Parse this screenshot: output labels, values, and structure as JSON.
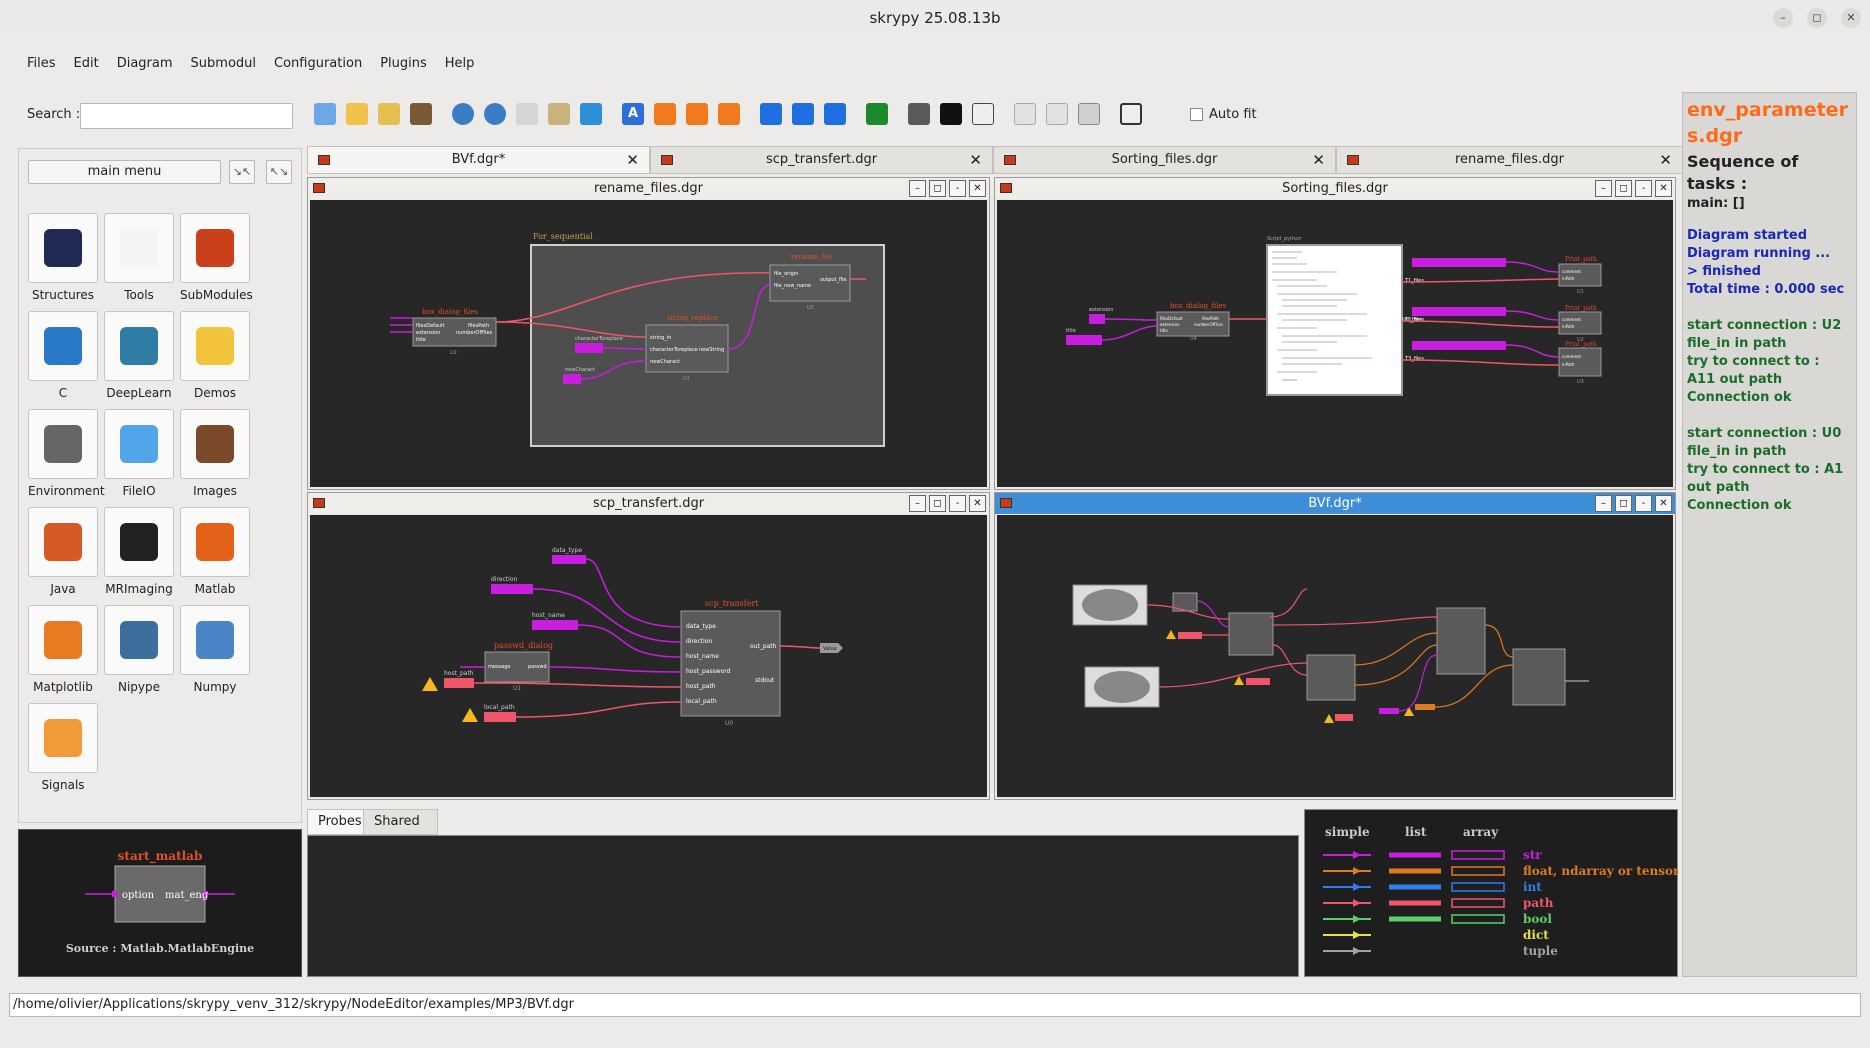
{
  "window": {
    "title": "skrypy 25.08.13b"
  },
  "menu": [
    "Files",
    "Edit",
    "Diagram",
    "Submodul",
    "Configuration",
    "Plugins",
    "Help"
  ],
  "search": {
    "label": "Search :",
    "value": ""
  },
  "toolbar": {
    "icons": [
      "new-file-icon",
      "open-folder-icon",
      "open-recent-icon",
      "edit-icon",
      "undo-icon",
      "redo-icon",
      "copy-icon",
      "paste-icon",
      "refresh-icon",
      "text-icon",
      "run-icon",
      "run-step-icon",
      "run-all-icon",
      "play-icon",
      "play-step-icon",
      "play-all-icon",
      "run-thread-icon",
      "tools-icon",
      "terminal-icon",
      "document-icon",
      "window-cascade-icon",
      "window-tile-icon",
      "window-grid-icon",
      "fit-screen-icon"
    ],
    "autofit_label": "Auto fit",
    "autofit_checked": false
  },
  "left_panel": {
    "main_menu_label": "main menu",
    "libraries": [
      {
        "label": "Structures",
        "icon": "structures-icon"
      },
      {
        "label": "Tools",
        "icon": "tools-icon"
      },
      {
        "label": "SubModules",
        "icon": "submodules-icon"
      },
      {
        "label": "C",
        "icon": "c-icon"
      },
      {
        "label": "DeepLearn",
        "icon": "deeplearn-icon"
      },
      {
        "label": "Demos",
        "icon": "python-icon"
      },
      {
        "label": "Environment",
        "icon": "gear-icon"
      },
      {
        "label": "FileIO",
        "icon": "file-icon"
      },
      {
        "label": "Images",
        "icon": "image-icon"
      },
      {
        "label": "Java",
        "icon": "java-icon"
      },
      {
        "label": "MRImaging",
        "icon": "mri-icon"
      },
      {
        "label": "Matlab",
        "icon": "matlab-icon"
      },
      {
        "label": "Matplotlib",
        "icon": "matplotlib-icon"
      },
      {
        "label": "Nipype",
        "icon": "brain-icon"
      },
      {
        "label": "Numpy",
        "icon": "numpy-icon"
      },
      {
        "label": "Signals",
        "icon": "signal-icon"
      }
    ],
    "preview": {
      "node": "start_matlab",
      "in_port": "option",
      "out_port": "mat_eng",
      "source": "Source : Matlab.MatlabEngine"
    }
  },
  "tabs": [
    {
      "label": "BVf.dgr*",
      "active": true
    },
    {
      "label": "scp_transfert.dgr",
      "active": false
    },
    {
      "label": "Sorting_files.dgr",
      "active": false
    },
    {
      "label": "rename_files.dgr",
      "active": false
    }
  ],
  "subwindows": [
    {
      "title": "rename_files.dgr",
      "active": false
    },
    {
      "title": "Sorting_files.dgr",
      "active": false
    },
    {
      "title": "scp_transfert.dgr",
      "active": false
    },
    {
      "title": "BVf.dgr*",
      "active": true
    }
  ],
  "diagram_text": {
    "rename": {
      "group": "For_sequential",
      "n1": "box_dialog_files",
      "n1_in": [
        "filesDefault",
        "extension",
        "title"
      ],
      "n1_out": [
        "filesPath",
        "numberOfFiles"
      ],
      "n1_id": "U2",
      "n2": "rename_file",
      "n2_in": [
        "file_origin",
        "file_new_name"
      ],
      "n2_out": "output_file",
      "n2_id": "U3",
      "n3": "string_replace",
      "n3_in": [
        "string_in",
        "characterToreplace",
        "newCharact"
      ],
      "n3_out": "newString",
      "n3_id": "U1",
      "c1": "characterToreplace",
      "c2": "newCharact"
    },
    "sorting": {
      "n1": "box_dialog_files",
      "n1_in": [
        "filesDefault",
        "extension",
        "title"
      ],
      "n1_out": [
        "filesPath",
        "numberOfFiles"
      ],
      "n1_id": "U4",
      "script_title": "Script_python",
      "script_out": "list_files",
      "labels": [
        "extension",
        "title"
      ],
      "outs": [
        "T1_files",
        "T2_files",
        "T3_files"
      ],
      "print": "Print_path",
      "print_in": [
        "comment",
        "inPath"
      ],
      "print_ids": [
        "U1",
        "U2",
        "U3"
      ]
    },
    "scp": {
      "n1": "passwd_dialog",
      "n1_in": "message",
      "n1_out": "passwd",
      "n1_id": "U1",
      "n2": "scp_transfert",
      "n2_in": [
        "data_type",
        "direction",
        "host_name",
        "host_password",
        "host_path",
        "local_path"
      ],
      "n2_out": [
        "out_path",
        "stdout"
      ],
      "n2_id": "U0",
      "c": [
        "data_type",
        "direction",
        "host_name",
        "host_path",
        "local_path"
      ],
      "val": "Value"
    }
  },
  "bottom_tabs": [
    {
      "label": "Probes",
      "active": true
    },
    {
      "label": "Shared Memory",
      "active": false
    }
  ],
  "legend": {
    "headers": [
      "simple",
      "list",
      "array"
    ],
    "types": [
      {
        "name": "str",
        "color": "#c81ee0"
      },
      {
        "name": "float, ndarray or tensor",
        "color": "#e07a1e"
      },
      {
        "name": "int",
        "color": "#2f7df0"
      },
      {
        "name": "path",
        "color": "#f0566a"
      },
      {
        "name": "bool",
        "color": "#5ad06a"
      },
      {
        "name": "dict",
        "color": "#e8e24a"
      },
      {
        "name": "tuple",
        "color": "#a3a3a3"
      }
    ]
  },
  "right_panel": {
    "title": "env_parameters.dgr",
    "seq": "Sequence of tasks :",
    "main": "main: []",
    "status": [
      "Diagram started",
      "Diagram running ...",
      "> finished",
      "Total time : 0.000 sec"
    ],
    "log": [
      {
        "text": "start connection : U2",
        "color": "dark"
      },
      {
        "text": "file_in in path",
        "color": "dark"
      },
      {
        "text": "try to connect to : A11 out path",
        "color": "dark"
      },
      {
        "text": "Connection ok",
        "color": "dark"
      },
      {
        "text": "",
        "color": "dark"
      },
      {
        "text": "start connection : U0",
        "color": "dark"
      },
      {
        "text": "file_in in path",
        "color": "dark"
      },
      {
        "text": "try to connect to : A1 out path",
        "color": "dark"
      },
      {
        "text": "Connection ok",
        "color": "dark"
      }
    ]
  },
  "statusbar": {
    "path": "/home/olivier/Applications/skrypy_venv_312/skrypy/NodeEditor/examples/MP3/BVf.dgr"
  }
}
